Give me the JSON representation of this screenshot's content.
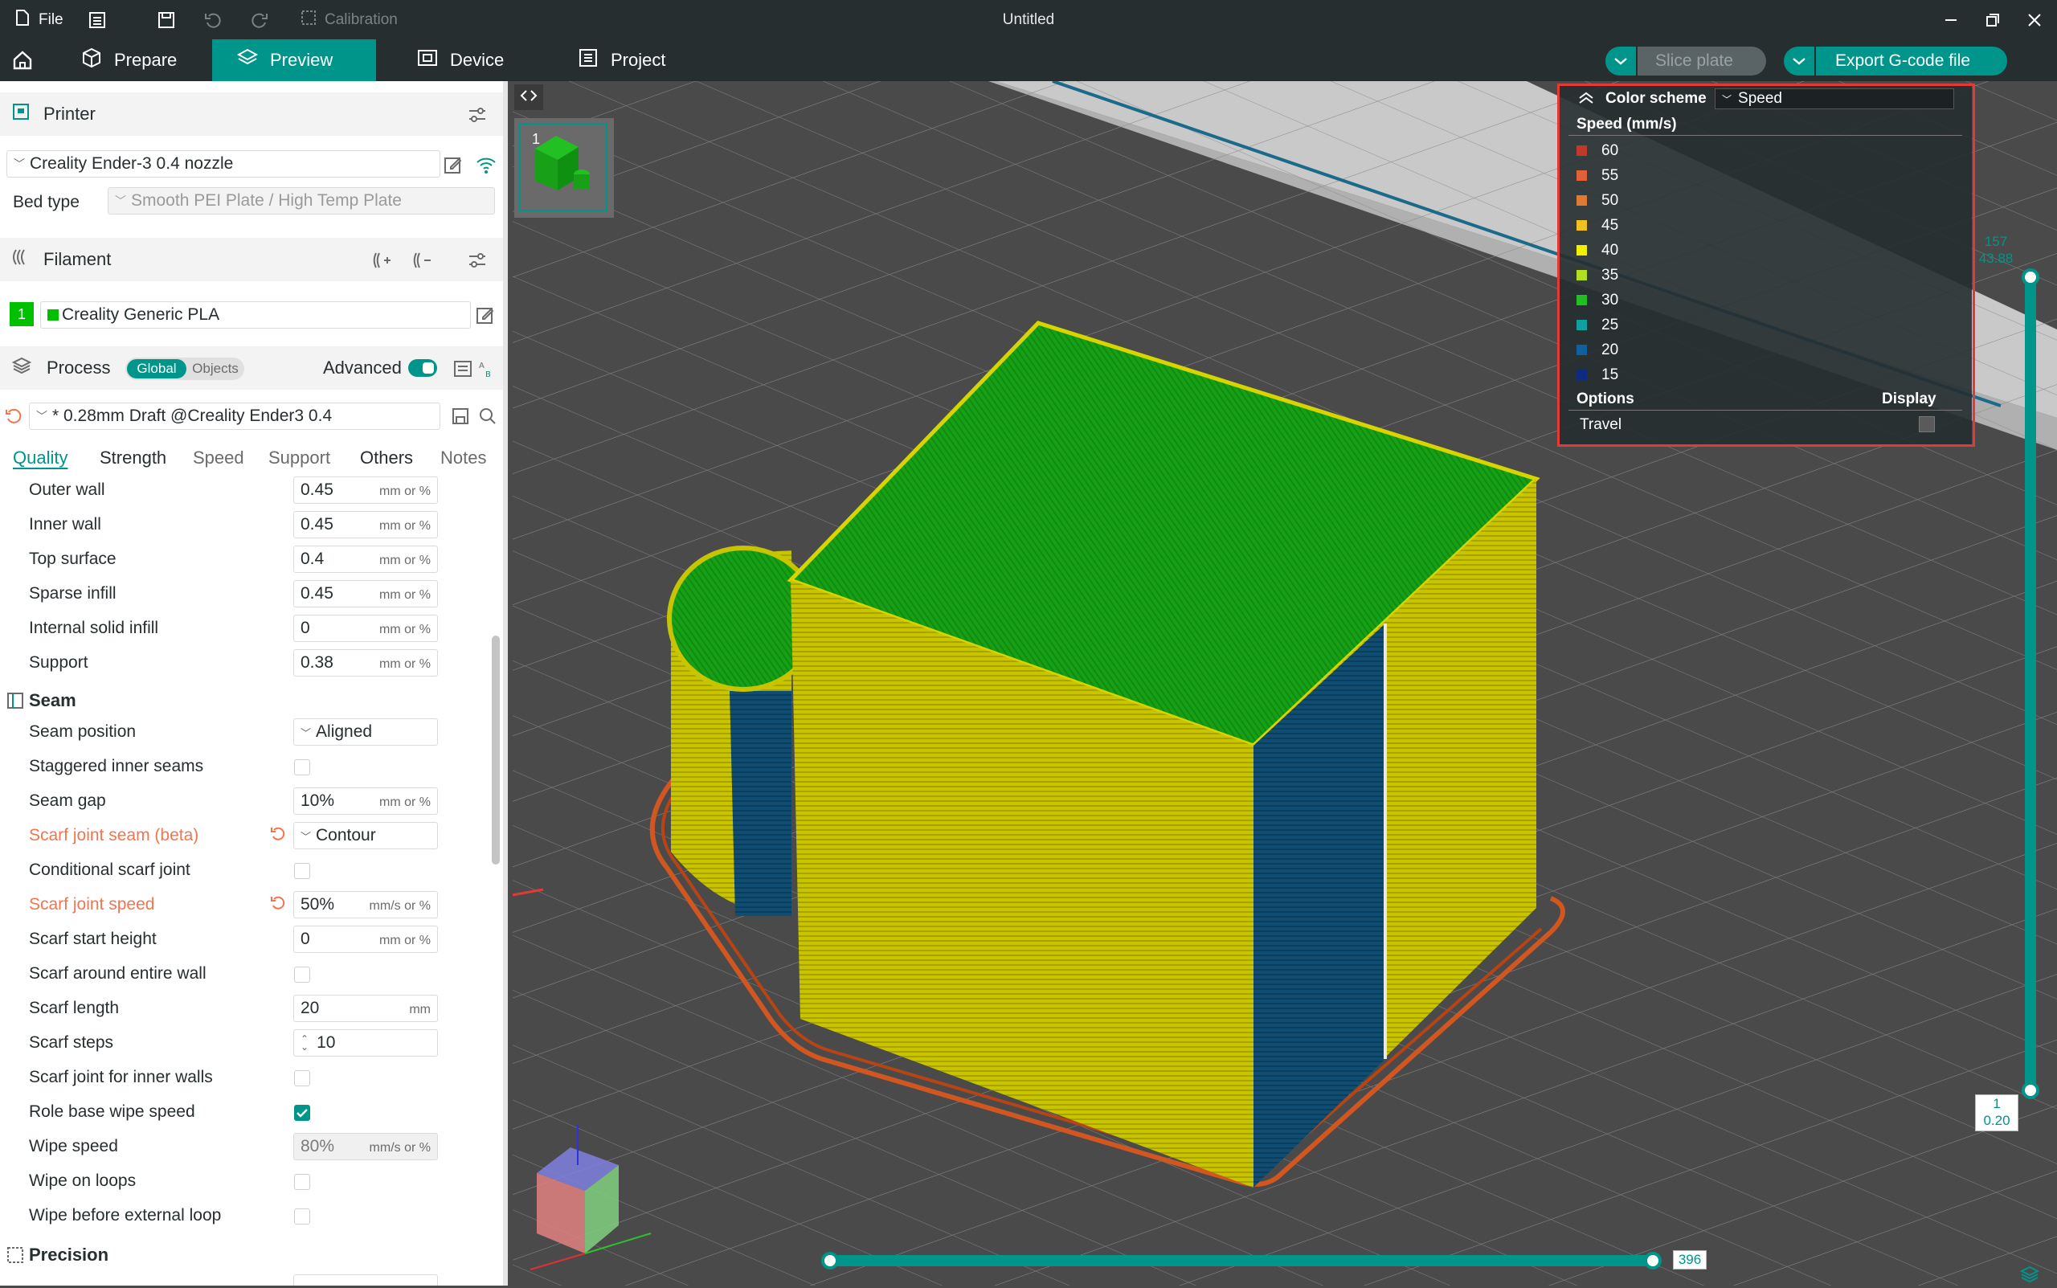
{
  "titlebar": {
    "file_label": "File",
    "calibration_label": "Calibration",
    "window_title": "Untitled"
  },
  "tabs": {
    "prepare": "Prepare",
    "preview": "Preview",
    "device": "Device",
    "project": "Project"
  },
  "actions": {
    "slice_plate": "Slice plate",
    "export_gcode": "Export G-code file"
  },
  "printer": {
    "section": "Printer",
    "name": "Creality Ender-3 0.4 nozzle",
    "bed_type_label": "Bed type",
    "bed_type_value": "Smooth PEI Plate / High Temp Plate"
  },
  "filament": {
    "section": "Filament",
    "slot": "1",
    "name": "Creality Generic PLA",
    "color": "#00c000"
  },
  "process": {
    "section": "Process",
    "global": "Global",
    "objects": "Objects",
    "advanced": "Advanced",
    "preset": "* 0.28mm Draft @Creality Ender3 0.4"
  },
  "subtabs": {
    "quality": "Quality",
    "strength": "Strength",
    "speed": "Speed",
    "support": "Support",
    "others": "Others",
    "notes": "Notes"
  },
  "settings": {
    "outer_wall": {
      "label": "Outer wall",
      "value": "0.45",
      "unit": "mm or %"
    },
    "inner_wall": {
      "label": "Inner wall",
      "value": "0.45",
      "unit": "mm or %"
    },
    "top_surface": {
      "label": "Top surface",
      "value": "0.4",
      "unit": "mm or %"
    },
    "sparse_infill": {
      "label": "Sparse infill",
      "value": "0.45",
      "unit": "mm or %"
    },
    "internal_solid_infill": {
      "label": "Internal solid infill",
      "value": "0",
      "unit": "mm or %"
    },
    "support": {
      "label": "Support",
      "value": "0.38",
      "unit": "mm or %"
    },
    "seam_group": "Seam",
    "seam_position": {
      "label": "Seam position",
      "value": "Aligned"
    },
    "staggered_inner_seams": {
      "label": "Staggered inner seams",
      "checked": false
    },
    "seam_gap": {
      "label": "Seam gap",
      "value": "10%",
      "unit": "mm or %"
    },
    "scarf_joint_seam": {
      "label": "Scarf joint seam (beta)",
      "value": "Contour"
    },
    "conditional_scarf_joint": {
      "label": "Conditional scarf joint",
      "checked": false
    },
    "scarf_joint_speed": {
      "label": "Scarf joint speed",
      "value": "50%",
      "unit": "mm/s or %"
    },
    "scarf_start_height": {
      "label": "Scarf start height",
      "value": "0",
      "unit": "mm or %"
    },
    "scarf_around_entire_wall": {
      "label": "Scarf around entire wall",
      "checked": false
    },
    "scarf_length": {
      "label": "Scarf length",
      "value": "20",
      "unit": "mm"
    },
    "scarf_steps": {
      "label": "Scarf steps",
      "value": "10"
    },
    "scarf_joint_inner_walls": {
      "label": "Scarf joint for inner walls",
      "checked": false
    },
    "role_base_wipe_speed": {
      "label": "Role base wipe speed",
      "checked": true
    },
    "wipe_speed": {
      "label": "Wipe speed",
      "value": "80%",
      "unit": "mm/s or %"
    },
    "wipe_on_loops": {
      "label": "Wipe on loops",
      "checked": false
    },
    "wipe_before_external_loop": {
      "label": "Wipe before external loop",
      "checked": false
    },
    "precision_group": "Precision"
  },
  "legend": {
    "title": "Color scheme",
    "scheme": "Speed",
    "unit_label": "Speed (mm/s)",
    "entries": [
      {
        "value": "60",
        "color": "#c0392b"
      },
      {
        "value": "55",
        "color": "#e0603a"
      },
      {
        "value": "50",
        "color": "#e07a30"
      },
      {
        "value": "45",
        "color": "#f0c020"
      },
      {
        "value": "40",
        "color": "#f0f000"
      },
      {
        "value": "35",
        "color": "#b0e020"
      },
      {
        "value": "30",
        "color": "#20c020"
      },
      {
        "value": "25",
        "color": "#10a0a0"
      },
      {
        "value": "20",
        "color": "#1060a0"
      },
      {
        "value": "15",
        "color": "#102a80"
      }
    ],
    "options_label": "Options",
    "display_label": "Display",
    "travel_label": "Travel"
  },
  "plate_thumb": {
    "number": "1"
  },
  "layer_slider": {
    "top_layer": "157",
    "top_height": "43.88",
    "bottom_layer": "1",
    "bottom_height": "0.20"
  },
  "move_slider": {
    "value": "396"
  },
  "colors": {
    "accent": "#00958a",
    "dark": "#262e30",
    "modified": "#f2754e",
    "highlight": "#e53935"
  }
}
